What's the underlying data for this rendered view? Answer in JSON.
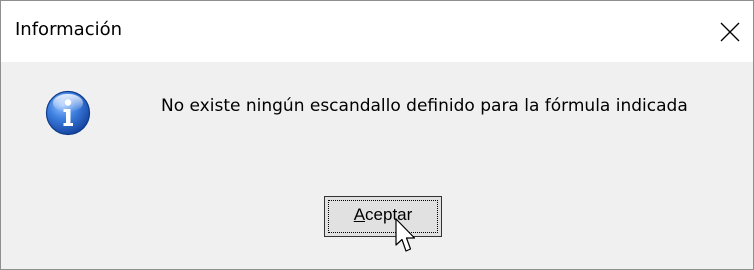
{
  "dialog": {
    "title": "Información",
    "message": "No existe ningún escandallo definido para la fórmula indicada",
    "icon": "info-icon",
    "ok_button": {
      "accelerator": "A",
      "rest": "ceptar"
    }
  },
  "colors": {
    "client_area": "#f0f0f0",
    "titlebar": "#ffffff",
    "button_face": "#e1e1e1",
    "info_blue": "#1f5fbf"
  }
}
